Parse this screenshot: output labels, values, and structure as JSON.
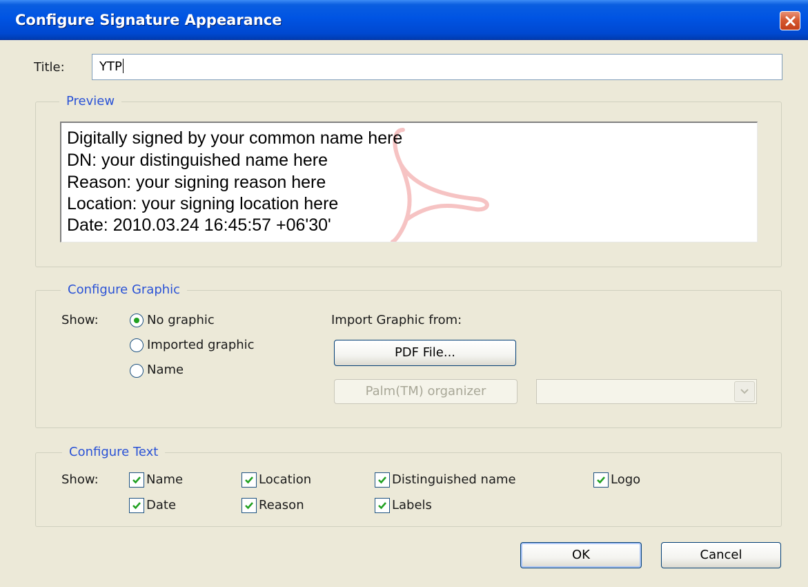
{
  "dialog": {
    "title": "Configure Signature Appearance"
  },
  "title_field": {
    "label": "Title:",
    "value": "YTP"
  },
  "preview": {
    "legend": "Preview",
    "lines": [
      "Digitally signed by your common name here",
      "DN: your distinguished name here",
      "Reason: your signing reason here",
      "Location: your signing location here",
      "Date: 2010.03.24 16:45:57 +06'30'"
    ],
    "watermark_icon": "acrobat-logo-icon"
  },
  "configure_graphic": {
    "legend": "Configure Graphic",
    "show_label": "Show:",
    "options": [
      {
        "label": "No graphic",
        "selected": true
      },
      {
        "label": "Imported graphic",
        "selected": false
      },
      {
        "label": "Name",
        "selected": false
      }
    ],
    "import_label": "Import Graphic from:",
    "pdf_button": "PDF File...",
    "palm_button": "Palm(TM) organizer",
    "palm_select_value": ""
  },
  "configure_text": {
    "legend": "Configure Text",
    "show_label": "Show:",
    "checkboxes": [
      {
        "label": "Name",
        "checked": true
      },
      {
        "label": "Location",
        "checked": true
      },
      {
        "label": "Distinguished name",
        "checked": true
      },
      {
        "label": "Logo",
        "checked": true
      },
      {
        "label": "Date",
        "checked": true
      },
      {
        "label": "Reason",
        "checked": true
      },
      {
        "label": "Labels",
        "checked": true
      }
    ]
  },
  "buttons": {
    "ok": "OK",
    "cancel": "Cancel"
  },
  "colors": {
    "titlebar": "#0054e3",
    "legend_text": "#2a52d6",
    "dialog_bg": "#ece9d8",
    "check": "#21a121",
    "close_button": "#d65a31"
  }
}
